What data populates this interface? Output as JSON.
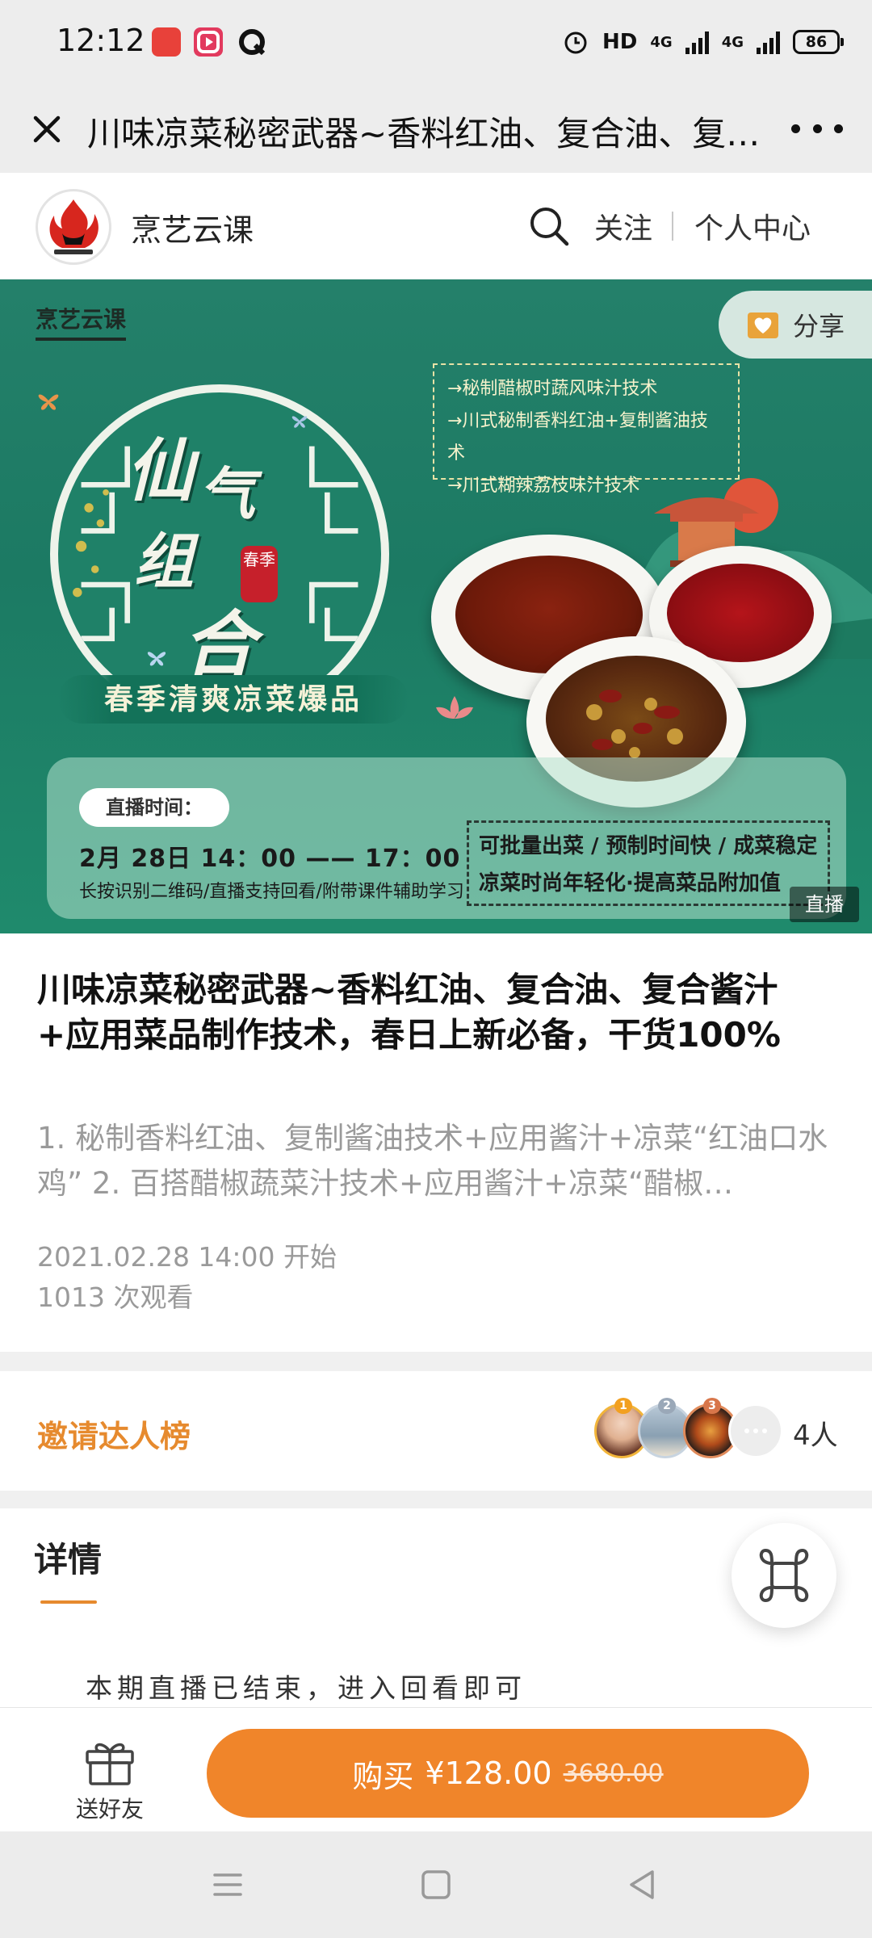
{
  "status_bar": {
    "time": "12:12",
    "hd_label": "HD",
    "network_1": "4G",
    "network_2": "4G",
    "battery": "86"
  },
  "nav": {
    "title": "川味凉菜秘密武器~香料红油、复合油、复合酱汁+应用菜品制作技术，春日上新必备，干货100%"
  },
  "channel": {
    "name": "烹艺云课",
    "follow": "关注",
    "profile": "个人中心"
  },
  "banner": {
    "brand": "烹艺云课",
    "share": "分享",
    "bullets": [
      "→秘制醋椒时蔬风味汁技术",
      "→川式秘制香料红油+复制酱油技术",
      "→川式糊辣荔枝味汁技术"
    ],
    "calligraphy": [
      "仙",
      "气",
      "组",
      "合"
    ],
    "seal": "春季",
    "ribbon": "春季清爽凉菜爆品",
    "live_label": "直播时间：",
    "live_datetime": "2月 28日  14：00 —— 17：00",
    "live_note": "长按识别二维码/直播支持回看/附带课件辅助学习",
    "features": [
      "可批量出菜 / 预制时间快 / 成菜稳定",
      "凉菜时尚年轻化·提高菜品附加值"
    ],
    "live_tag": "直播"
  },
  "course": {
    "title": "川味凉菜秘密武器~香料红油、复合油、复合酱汁+应用菜品制作技术，春日上新必备，干货100%",
    "description": "1. 秘制香料红油、复制酱油技术+应用酱汁+凉菜“红油口水鸡” 2. 百搭醋椒蔬菜汁技术+应用酱汁+凉菜“醋椒…",
    "start": "2021.02.28 14:00 开始",
    "views": "1013 次观看"
  },
  "invite": {
    "title": "邀请达人榜",
    "count": "4人",
    "ranks": [
      "1",
      "2",
      "3"
    ]
  },
  "details": {
    "tab": "详情",
    "text": "本期直播已结束，进入回看即可"
  },
  "bottom": {
    "gift_label": "送好友",
    "buy_label": "购买",
    "price": "¥128.00",
    "original_price": "3680.00"
  },
  "colors": {
    "accent": "#f0852a",
    "invite_title": "#e68a2e",
    "banner_green": "#1f8a6c"
  }
}
